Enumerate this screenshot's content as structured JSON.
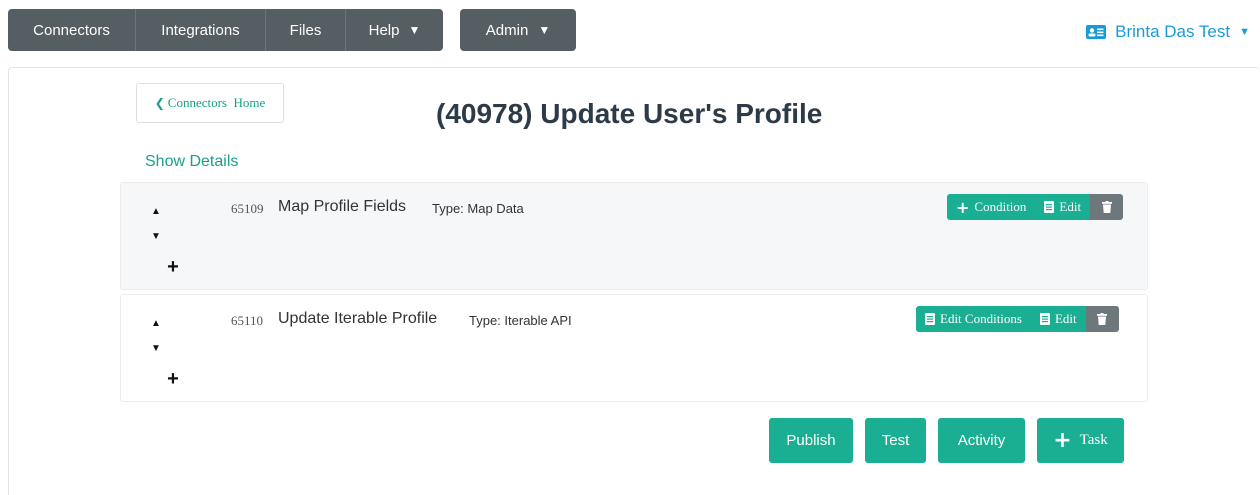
{
  "nav": {
    "items": [
      {
        "label": "Connectors"
      },
      {
        "label": "Integrations"
      },
      {
        "label": "Files"
      },
      {
        "label": "Help",
        "caret": "▼"
      }
    ],
    "admin_label": "Admin",
    "caret": "▼"
  },
  "user": {
    "name": "Brinta Das Test",
    "caret": "▼",
    "icon": "id-card-icon",
    "color": "#1a9ad6"
  },
  "home_button": {
    "label": "Connectors  Home",
    "chevron": "❮"
  },
  "page_title": "(40978) Update User's Profile",
  "show_details": "Show Details",
  "tasks": [
    {
      "id": "65109",
      "name": "Map Profile Fields",
      "type": "Type: Map Data",
      "actions": {
        "primary": "Condition",
        "edit": "Edit"
      }
    },
    {
      "id": "65110",
      "name": "Update Iterable Profile",
      "type": "Type: Iterable API",
      "actions": {
        "primary": "Edit Conditions",
        "edit": "Edit"
      }
    }
  ],
  "icons": {
    "up": "▲",
    "down": "▼",
    "plus": "+",
    "trash": "trash-icon",
    "doc": "document-icon"
  },
  "bottom": {
    "publish": "Publish",
    "test": "Test",
    "activity": "Activity",
    "task": "Task"
  },
  "colors": {
    "accent": "#1aae93",
    "nav": "#555e63",
    "link": "#1aa08a",
    "title": "#2d3a47"
  }
}
